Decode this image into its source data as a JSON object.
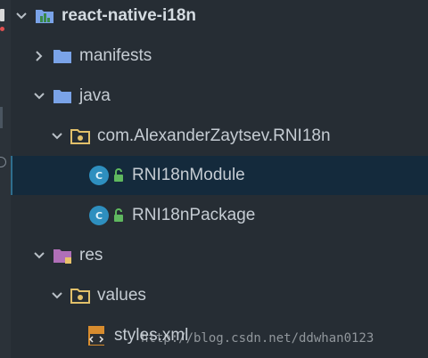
{
  "tree": {
    "root": "react-native-i18n",
    "manifests": "manifests",
    "java": "java",
    "package": "com.AlexanderZaytsev.RNI18n",
    "module": "RNI18nModule",
    "package_class": "RNI18nPackage",
    "res": "res",
    "values": "values",
    "styles": "styles.xml"
  },
  "watermark": "http://blog.csdn.net/ddwhan0123",
  "colors": {
    "background": "#262d34",
    "selection": "#142a3c",
    "folder_blue": "#7aa3e8",
    "folder_res": "#b06fb8",
    "class_icon": "#2e8fbf",
    "lock_green": "#5fb85f",
    "text": "#c5ccd3"
  },
  "icons": [
    "chevron-down-icon",
    "chevron-right-icon",
    "module-folder-icon",
    "folder-icon",
    "package-folder-icon",
    "class-icon",
    "lock-icon",
    "xml-file-icon"
  ]
}
